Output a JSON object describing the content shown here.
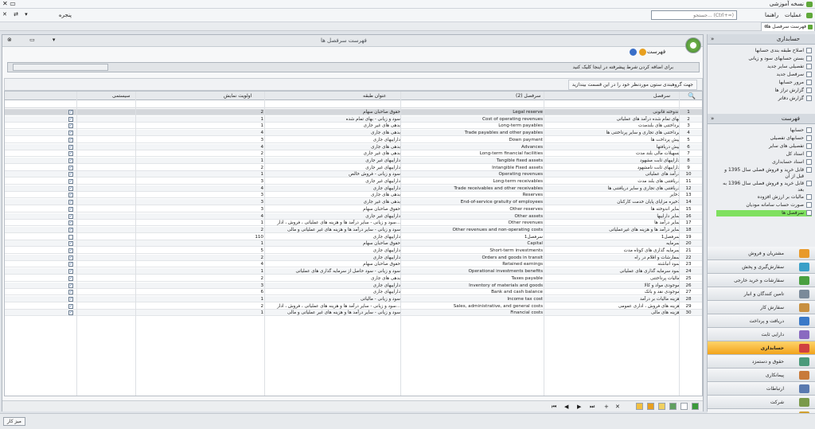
{
  "titlebar": {
    "title": "نسخه آموزشی"
  },
  "menubar": {
    "items": [
      "عملیات",
      "راهنما",
      "پنجره"
    ],
    "search_placeholder": "جستجو... (Ctrl+=)"
  },
  "tab": {
    "label": "فهرست سرفصل ها"
  },
  "document": {
    "title": "فهرست سرفصل ها",
    "toolbar_label": "فهرست",
    "filter_hint": "برای اضافه کردن شرط پیشرفته در اینجا کلیک کنید",
    "group_hint": "جهت گروهبندی ستون موردنظر خود را در این قسمت بیندازید"
  },
  "grid": {
    "columns": {
      "sarfasl": "سرفصل",
      "sarfasl2": "سرفصل (2)",
      "group": "عنوان طبقه",
      "priority": "اولویت نمایش",
      "system": "سیستمی"
    },
    "rows": [
      {
        "num": "1",
        "sarfasl": "اندوخته قانونی",
        "sarfasl2": "Legal reserve",
        "group": "حقوق صاحبان سهام",
        "priority": "2",
        "checked": true
      },
      {
        "num": "2",
        "sarfasl": "بهای تمام شده درآمد های عملیاتی",
        "sarfasl2": "Cost of operating revenues",
        "group": "سود و زیانی - بهای تمام شده",
        "priority": "1",
        "checked": true
      },
      {
        "num": "3",
        "sarfasl": "پرداختنی های بلندمدت",
        "sarfasl2": "Long-term payables",
        "group": "بدهی های غیر جاری",
        "priority": "1",
        "checked": true
      },
      {
        "num": "4",
        "sarfasl": "پرداختنی های تجاری و سایر پرداختنی ها",
        "sarfasl2": "Trade payables and other payables",
        "group": "بدهی های جاری",
        "priority": "4",
        "checked": true
      },
      {
        "num": "5",
        "sarfasl": "پیش پرداخت ها",
        "sarfasl2": "Down payment",
        "group": "داراییهای جاری",
        "priority": "3",
        "checked": true
      },
      {
        "num": "6",
        "sarfasl": "پیش دریافتها",
        "sarfasl2": "Advances",
        "group": "بدهی های جاری",
        "priority": "4",
        "checked": true
      },
      {
        "num": "7",
        "sarfasl": "تسهیلات مالی بلند مدت",
        "sarfasl2": "Long-term financial facilities",
        "group": "بدهی های غیر جاری",
        "priority": "2",
        "checked": true
      },
      {
        "num": "8",
        "sarfasl": "داراییهای ثابت مشهود",
        "sarfasl2": "Tangible fixed assets",
        "group": "داراییهای غیر جاری",
        "priority": "1",
        "checked": true
      },
      {
        "num": "9",
        "sarfasl": "داراییهای ثابت نامشهود",
        "sarfasl2": "Intangible Fixed assets",
        "group": "داراییهای غیر جاری",
        "priority": "2",
        "checked": true
      },
      {
        "num": "10",
        "sarfasl": "درآمد های عملیاتی",
        "sarfasl2": "Operating revenues",
        "group": "سود و زیانی - فروش خالص",
        "priority": "1",
        "checked": true
      },
      {
        "num": "11",
        "sarfasl": "دریافتنی های بلند مدت",
        "sarfasl2": "Long-term receivables",
        "group": "داراییهای غیر جاری",
        "priority": "3",
        "checked": true
      },
      {
        "num": "12",
        "sarfasl": "دریافتنی های تجاری و سایر دریافتنی ها",
        "sarfasl2": "Trade receivables and other receivables",
        "group": "داراییهای جاری",
        "priority": "4",
        "checked": true
      },
      {
        "num": "13",
        "sarfasl": "ذخایر",
        "sarfasl2": "Reserves",
        "group": "بدهی های جاری",
        "priority": "3",
        "checked": true
      },
      {
        "num": "14",
        "sarfasl": "ذخیره مزایای پایان خدمت کارکنان",
        "sarfasl2": "End-of-service gratuity of employees",
        "group": "بدهی های غیر جاری",
        "priority": "3",
        "checked": true
      },
      {
        "num": "15",
        "sarfasl": "سایر اندوخته ها",
        "sarfasl2": "Other reserves",
        "group": "حقوق صاحبان سهام",
        "priority": "3",
        "checked": true
      },
      {
        "num": "16",
        "sarfasl": "سایر داراییها",
        "sarfasl2": "Other assets",
        "group": "داراییهای غیر جاری",
        "priority": "4",
        "checked": true
      },
      {
        "num": "17",
        "sarfasl": "سایر درآمد ها",
        "sarfasl2": "Other revenues",
        "group": "سود و زیانی - سایر درآمد ها و هزینه های عملیاتی ، فروش ، ادار...",
        "priority": "1",
        "checked": true
      },
      {
        "num": "18",
        "sarfasl": "سایر درآمد ها و هزینه های غیرعملیاتی",
        "sarfasl2": "Other revenues and non-operating costs",
        "group": "سود و زیانی - سایر درآمد ها و هزینه های غیر عملیاتی و مالی",
        "priority": "2",
        "checked": true
      },
      {
        "num": "19",
        "sarfasl": "سرفصل1",
        "sarfasl2": "سرفصل1",
        "group": "داراییهای جاری",
        "priority": "110",
        "checked": false
      },
      {
        "num": "20",
        "sarfasl": "سرمایه",
        "sarfasl2": "Capital",
        "group": "حقوق صاحبان سهام",
        "priority": "1",
        "checked": true
      },
      {
        "num": "21",
        "sarfasl": "سرمایه گذاری های کوتاه مدت",
        "sarfasl2": "Short-term investments",
        "group": "داراییهای جاری",
        "priority": "5",
        "checked": true
      },
      {
        "num": "22",
        "sarfasl": "سفارشات و اقلام در راه",
        "sarfasl2": "Orders and goods in transit",
        "group": "داراییهای جاری",
        "priority": "2",
        "checked": true
      },
      {
        "num": "23",
        "sarfasl": "سود انباشته",
        "sarfasl2": "Retained earnings",
        "group": "حقوق صاحبان سهام",
        "priority": "4",
        "checked": true
      },
      {
        "num": "24",
        "sarfasl": "سود سرمایه گذاری های عملیاتی",
        "sarfasl2": "Operational investments benefits",
        "group": "سود و زیانی - سود حاصل از سرمایه گذاری های عملیاتی",
        "priority": "1",
        "checked": true
      },
      {
        "num": "25",
        "sarfasl": "مالیات پرداختنی",
        "sarfasl2": "Taxes payable",
        "group": "بدهی های جاری",
        "priority": "2",
        "checked": true
      },
      {
        "num": "26",
        "sarfasl": "موجودی مواد و کالا",
        "sarfasl2": "Inventory of materials and goods",
        "group": "داراییهای جاری",
        "priority": "3",
        "checked": true
      },
      {
        "num": "27",
        "sarfasl": "موجودی نقد و بانک",
        "sarfasl2": "Bank and cash balance",
        "group": "داراییهای جاری",
        "priority": "6",
        "checked": true
      },
      {
        "num": "28",
        "sarfasl": "هزینه مالیات بر درآمد",
        "sarfasl2": "Income tax cost",
        "group": "سود و زیانی - مالیاتی",
        "priority": "1",
        "checked": true
      },
      {
        "num": "29",
        "sarfasl": "هزینه های فروش ، اداری عمومی",
        "sarfasl2": "Sales, administrative, and general costs",
        "group": "سود و زیانی - سایر درآمد ها و هزینه های عملیاتی ، فروش ، ادار...",
        "priority": "2",
        "checked": true
      },
      {
        "num": "30",
        "sarfasl": "هزینه های مالی",
        "sarfasl2": "Financial costs",
        "group": "سود و زیانی - سایر درآمد ها و هزینه های غیر عملیاتی و مالی",
        "priority": "1",
        "checked": true
      }
    ]
  },
  "sidebar": {
    "section1": {
      "title": "حسابداری",
      "items": [
        "اصلاح طبقه بندی حسابها",
        "بستن حسابهای سود و زیانی",
        "تفصیلی سایر جدید",
        "سرفصل جدید",
        "مرور حسابها",
        "گزارش تراز ها",
        "گزارش دفاتر"
      ]
    },
    "section2": {
      "title": "فهرست",
      "items": [
        "حسابها",
        "حسابهای تفصیلی",
        "تفصیلی های سایر",
        "اسناد کل",
        "اسناد حسابداری",
        "قابل خرید و فروش فصلی سال 1395 و قبل از آن",
        "قابل خرید و فروش فصلی سال 1396 به بعد",
        "مالیات بر ارزش افزوده",
        "صورت حساب سامانه مودیان",
        "سرفصل ها"
      ]
    },
    "nav": [
      {
        "label": "مشتریان و فروش",
        "color": "#e89a2a"
      },
      {
        "label": "سفارش‌گیری و پخش",
        "color": "#3aa0c8"
      },
      {
        "label": "سفارشات و خرید خارجی",
        "color": "#4aa040"
      },
      {
        "label": "تامین کنندگان و انبار",
        "color": "#7a8a9a"
      },
      {
        "label": "سفارش کار",
        "color": "#c89040"
      },
      {
        "label": "دریافت و پرداخت",
        "color": "#3a7ac8"
      },
      {
        "label": "دارایی ثابت",
        "color": "#8a6ac0"
      },
      {
        "label": "حسابداری",
        "color": "#d04040"
      },
      {
        "label": "حقوق و دستمزد",
        "color": "#4a9a7a"
      },
      {
        "label": "پیمانکاری",
        "color": "#c87a3a"
      },
      {
        "label": "ارتباطات",
        "color": "#5a7ab0"
      },
      {
        "label": "شرکت",
        "color": "#7a9a4a"
      },
      {
        "label": "تنظیمات",
        "color": "#d0a030"
      }
    ]
  },
  "statusbar": {
    "label": "میز کار"
  }
}
